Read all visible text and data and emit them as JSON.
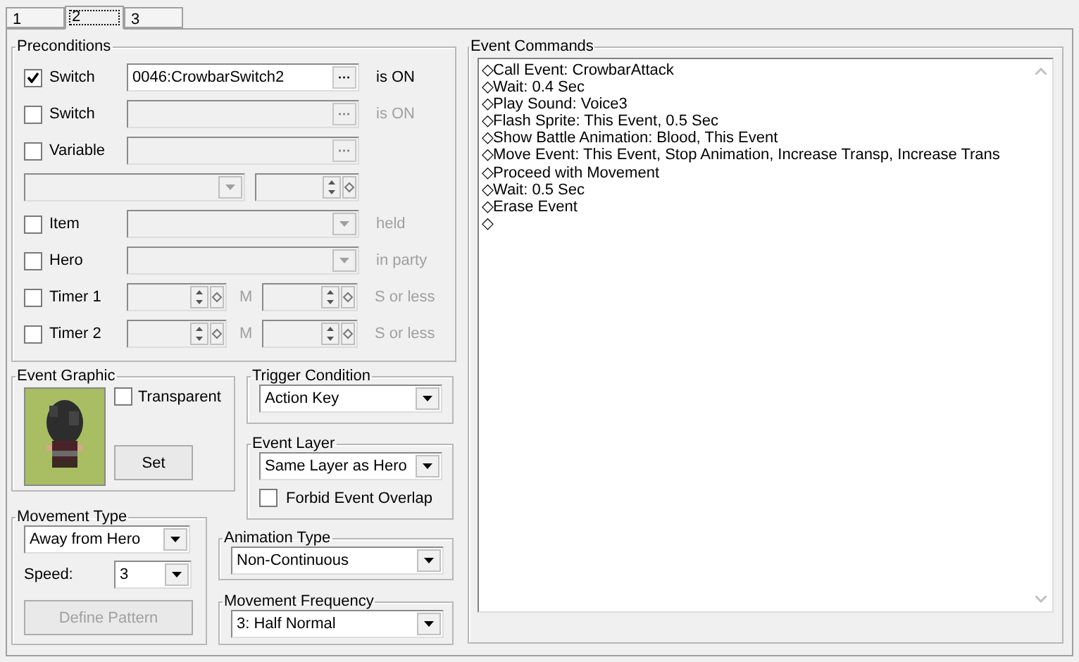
{
  "tabs": [
    {
      "label": "1",
      "selected": false
    },
    {
      "label": "2",
      "selected": true
    },
    {
      "label": "3",
      "selected": false
    }
  ],
  "preconditions": {
    "title": "Preconditions",
    "rows": [
      {
        "kind": "field",
        "label": "Switch",
        "checked": true,
        "value": "0046:CrowbarSwitch2",
        "button": "···",
        "suffix": "is ON"
      },
      {
        "kind": "field",
        "label": "Switch",
        "checked": false,
        "button": "···",
        "suffix": "is ON"
      },
      {
        "kind": "field",
        "label": "Variable",
        "checked": false,
        "button": "···"
      },
      {
        "kind": "compare"
      },
      {
        "kind": "dropdown",
        "label": "Item",
        "checked": false,
        "suffix": "held"
      },
      {
        "kind": "dropdown",
        "label": "Hero",
        "checked": false,
        "suffix": "in party"
      },
      {
        "kind": "timer",
        "label": "Timer 1",
        "checked": false,
        "unit": "M",
        "suffix": "S or less"
      },
      {
        "kind": "timer",
        "label": "Timer 2",
        "checked": false,
        "unit": "M",
        "suffix": "S or less"
      }
    ]
  },
  "event_graphic": {
    "title": "Event Graphic",
    "transparent_label": "Transparent",
    "transparent": false,
    "set_button": "Set"
  },
  "trigger_condition": {
    "title": "Trigger Condition",
    "value": "Action Key"
  },
  "event_layer": {
    "title": "Event Layer",
    "value": "Same Layer as Hero",
    "overlap_label": "Forbid Event Overlap",
    "forbid_overlap": false
  },
  "movement_type": {
    "title": "Movement Type",
    "value": "Away from Hero",
    "speed_label": "Speed:",
    "speed": "3",
    "pattern_button": "Define Pattern",
    "pattern_disabled": true
  },
  "animation_type": {
    "title": "Animation Type",
    "value": "Non-Continuous"
  },
  "movement_frequency": {
    "title": "Movement Frequency",
    "value": "3: Half Normal"
  },
  "event_commands": {
    "title": "Event Commands",
    "lines": [
      "◇Call Event: CrowbarAttack",
      "◇Wait: 0.4 Sec",
      "◇Play Sound: Voice3",
      "◇Flash Sprite: This Event, 0.5 Sec",
      "◇Show Battle Animation: Blood, This Event",
      "◇Move Event: This Event, Stop Animation, Increase Transp, Increase Trans",
      "◇Proceed with Movement",
      "◇Wait: 0.5 Sec",
      "◇Erase Event",
      "◇"
    ]
  }
}
